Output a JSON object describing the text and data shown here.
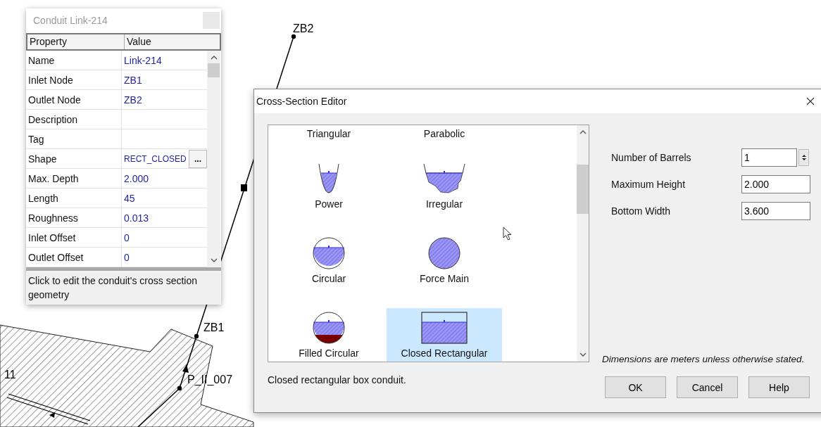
{
  "map": {
    "nodes": [
      {
        "label": "ZB2"
      },
      {
        "label": "ZB1"
      },
      {
        "label": "P_II_007"
      },
      {
        "label": "11"
      }
    ]
  },
  "property_window": {
    "title": "Conduit Link-214",
    "columns": [
      "Property",
      "Value"
    ],
    "rows": [
      {
        "property": "Name",
        "value": "Link-214"
      },
      {
        "property": "Inlet Node",
        "value": "ZB1"
      },
      {
        "property": "Outlet Node",
        "value": "ZB2"
      },
      {
        "property": "Description"
      },
      {
        "property": "Tag"
      },
      {
        "property": "Shape",
        "value": "RECT_CLOSED",
        "button": "..."
      },
      {
        "property": "Max. Depth",
        "value": "2.000"
      },
      {
        "property": "Length",
        "value": "45"
      },
      {
        "property": "Roughness",
        "value": "0.013"
      },
      {
        "property": "Inlet Offset",
        "value": "0"
      },
      {
        "property": "Outlet Offset",
        "value": "0"
      }
    ],
    "help_text": "Click to edit the conduit's cross section geometry"
  },
  "editor": {
    "title": "Cross-Section Editor",
    "shapes": [
      {
        "label": "Triangular",
        "selected": false
      },
      {
        "label": "Parabolic",
        "selected": false
      },
      {
        "label": "Power",
        "kind": "power",
        "selected": false
      },
      {
        "label": "Irregular",
        "kind": "irregular",
        "selected": false
      },
      {
        "label": "Circular",
        "kind": "circular",
        "selected": false
      },
      {
        "label": "Force Main",
        "kind": "force_main",
        "selected": false
      },
      {
        "label": "Filled Circular",
        "kind": "filled_circular",
        "selected": false
      },
      {
        "label": "Closed Rectangular",
        "kind": "closed_rectangular",
        "selected": true
      }
    ],
    "description": "Closed rectangular box conduit.",
    "fields": [
      {
        "label": "Number of Barrels",
        "value": "1",
        "kind": "spin"
      },
      {
        "label": "Maximum Height",
        "value": "2.000",
        "kind": "text"
      },
      {
        "label": "Bottom Width",
        "value": "3.600",
        "kind": "text"
      }
    ],
    "note": "Dimensions are meters unless otherwise stated.",
    "buttons": [
      "OK",
      "Cancel",
      "Help"
    ]
  }
}
